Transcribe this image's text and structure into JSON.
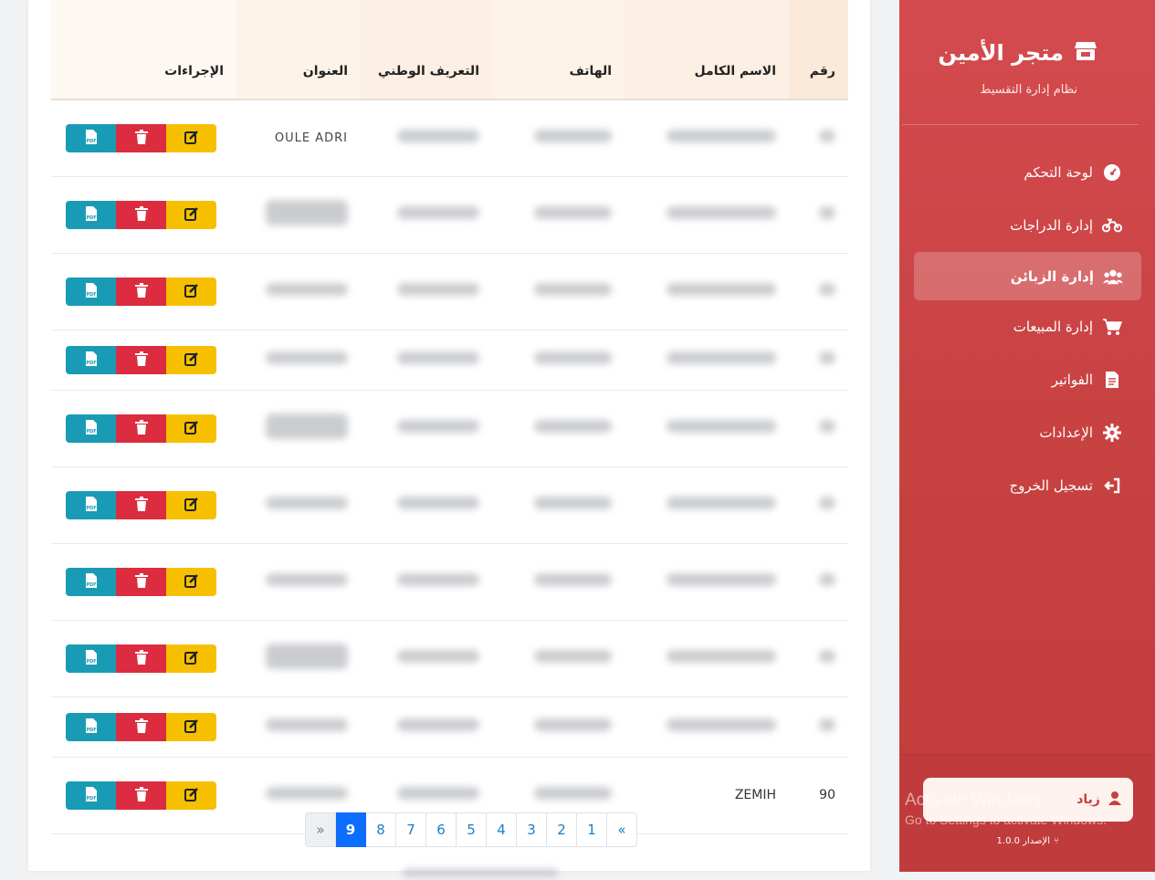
{
  "table": {
    "headers": {
      "number": "رقم",
      "full_name": "الاسم الكامل",
      "phone": "الهاتف",
      "national_id": "التعريف الوطني",
      "address": "العنوان",
      "actions": "الإجراءات"
    },
    "rows": [
      {
        "number": "",
        "full_name": "",
        "phone": "",
        "national_id": "",
        "address": "OULE ADRI"
      },
      {
        "number": "",
        "full_name": "",
        "phone": "",
        "national_id": "",
        "address": ""
      },
      {
        "number": "",
        "full_name": "",
        "phone": "",
        "national_id": "",
        "address": ""
      },
      {
        "number": "",
        "full_name": "",
        "phone": "",
        "national_id": "",
        "address": ""
      },
      {
        "number": "",
        "full_name": "",
        "phone": "",
        "national_id": "",
        "address": ""
      },
      {
        "number": "",
        "full_name": "",
        "phone": "",
        "national_id": "",
        "address": ""
      },
      {
        "number": "",
        "full_name": "",
        "phone": "",
        "national_id": "",
        "address": ""
      },
      {
        "number": "",
        "full_name": "",
        "phone": "",
        "national_id": "",
        "address": ""
      },
      {
        "number": "",
        "full_name": "",
        "phone": "",
        "national_id": "",
        "address": ""
      },
      {
        "number": "90",
        "full_name": "ZEMIH",
        "phone": "",
        "national_id": "",
        "address": ""
      }
    ],
    "row_actions": {
      "edit_icon": "edit-icon",
      "delete_icon": "trash-icon",
      "pdf_icon": "pdf-file-icon",
      "pdf_badge": "PDF"
    }
  },
  "pagination": {
    "prev": "«",
    "pages": [
      "1",
      "2",
      "3",
      "4",
      "5",
      "6",
      "7",
      "8",
      "9"
    ],
    "active_page": "9",
    "next": "»"
  },
  "sidebar": {
    "brand_title": "متجر الأمين",
    "brand_subtitle": "نظام إدارة التقسيط",
    "items": [
      {
        "label": "لوحة التحكم",
        "icon": "dashboard-gauge-icon"
      },
      {
        "label": "إدارة الدراجات",
        "icon": "motorcycle-icon"
      },
      {
        "label": "إدارة الزبائن",
        "icon": "users-icon",
        "active": true
      },
      {
        "label": "إدارة المبيعات",
        "icon": "cart-icon"
      },
      {
        "label": "الفواتير",
        "icon": "invoice-icon"
      },
      {
        "label": "الإعدادات",
        "icon": "gear-icon"
      },
      {
        "label": "تسجيل الخروج",
        "icon": "logout-icon"
      }
    ],
    "user_name": "زياد",
    "version_label": "الإصدار 1.0.0"
  },
  "os_watermark": {
    "line1": "Activate Windows",
    "line2": "Go to Settings to activate Windows."
  },
  "colors": {
    "sidebar_bg": "#d44b4f",
    "pdf_button": "#1a9bb5",
    "delete_button": "#dc2c3f",
    "edit_button": "#f6c000",
    "active_page": "#0d6efd"
  }
}
